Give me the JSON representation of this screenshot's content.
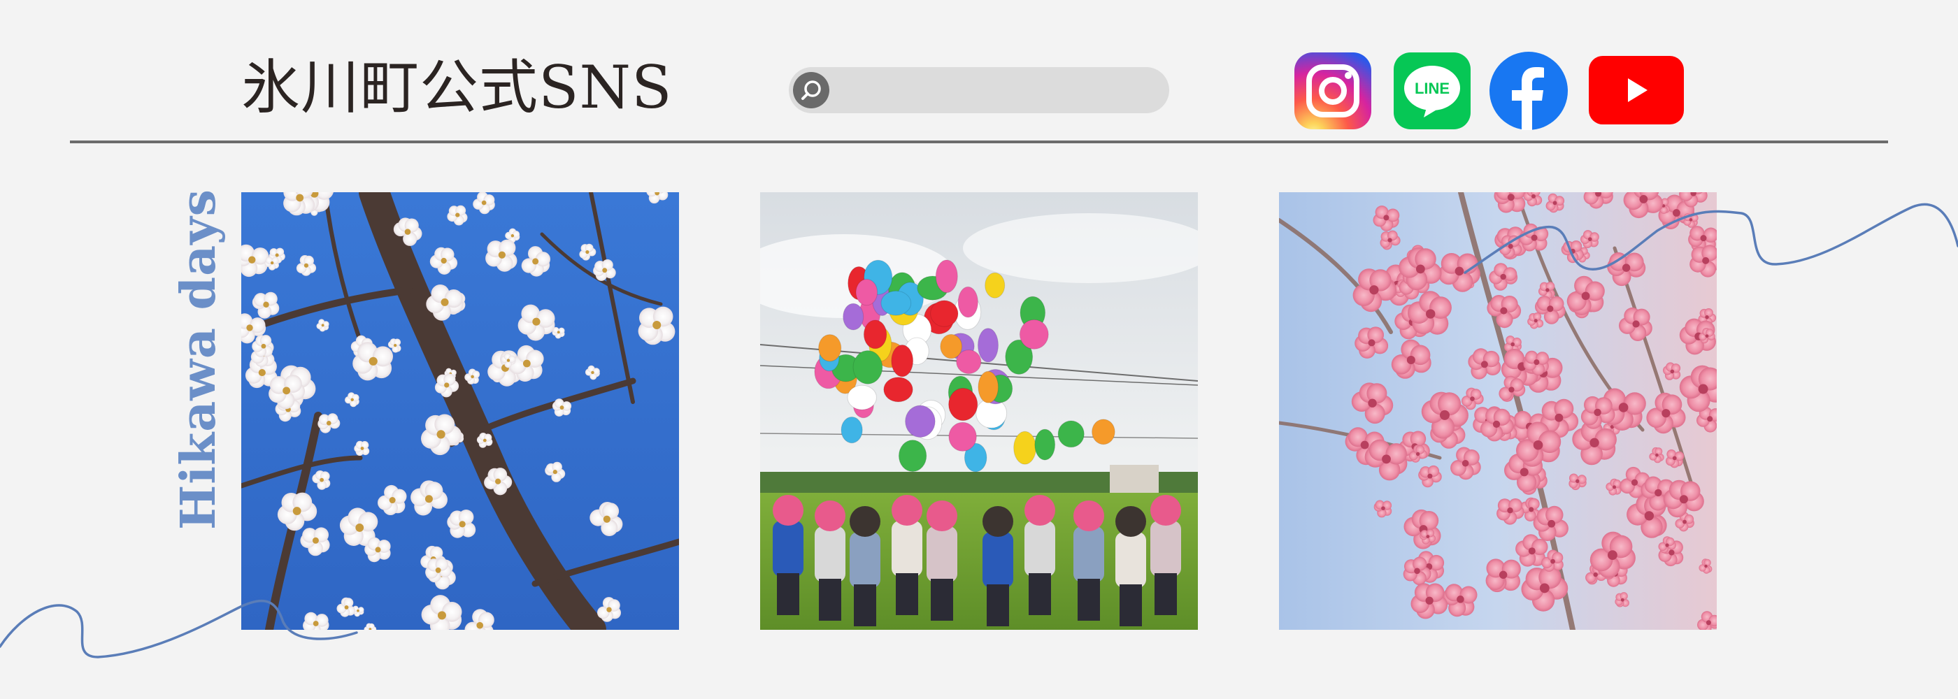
{
  "header": {
    "title": "氷川町公式SNS",
    "search": {
      "placeholder": ""
    }
  },
  "social_links": [
    {
      "name": "Instagram",
      "icon": "instagram-icon"
    },
    {
      "name": "LINE",
      "icon": "line-icon",
      "label": "LINE"
    },
    {
      "name": "Facebook",
      "icon": "facebook-icon"
    },
    {
      "name": "YouTube",
      "icon": "youtube-icon"
    }
  ],
  "gallery": {
    "side_title": "Hikawa days",
    "photos": [
      {
        "subject": "white plum blossoms against blue sky"
      },
      {
        "subject": "children releasing colorful balloons in a field"
      },
      {
        "subject": "pink weeping plum blossoms"
      }
    ]
  },
  "colors": {
    "background": "#f3f3f3",
    "accent_blue": "#6b8fc8",
    "wave_line": "#5a7db8",
    "instagram": "#d62976",
    "line": "#06c755",
    "facebook": "#1877f2",
    "youtube": "#ff0000"
  }
}
